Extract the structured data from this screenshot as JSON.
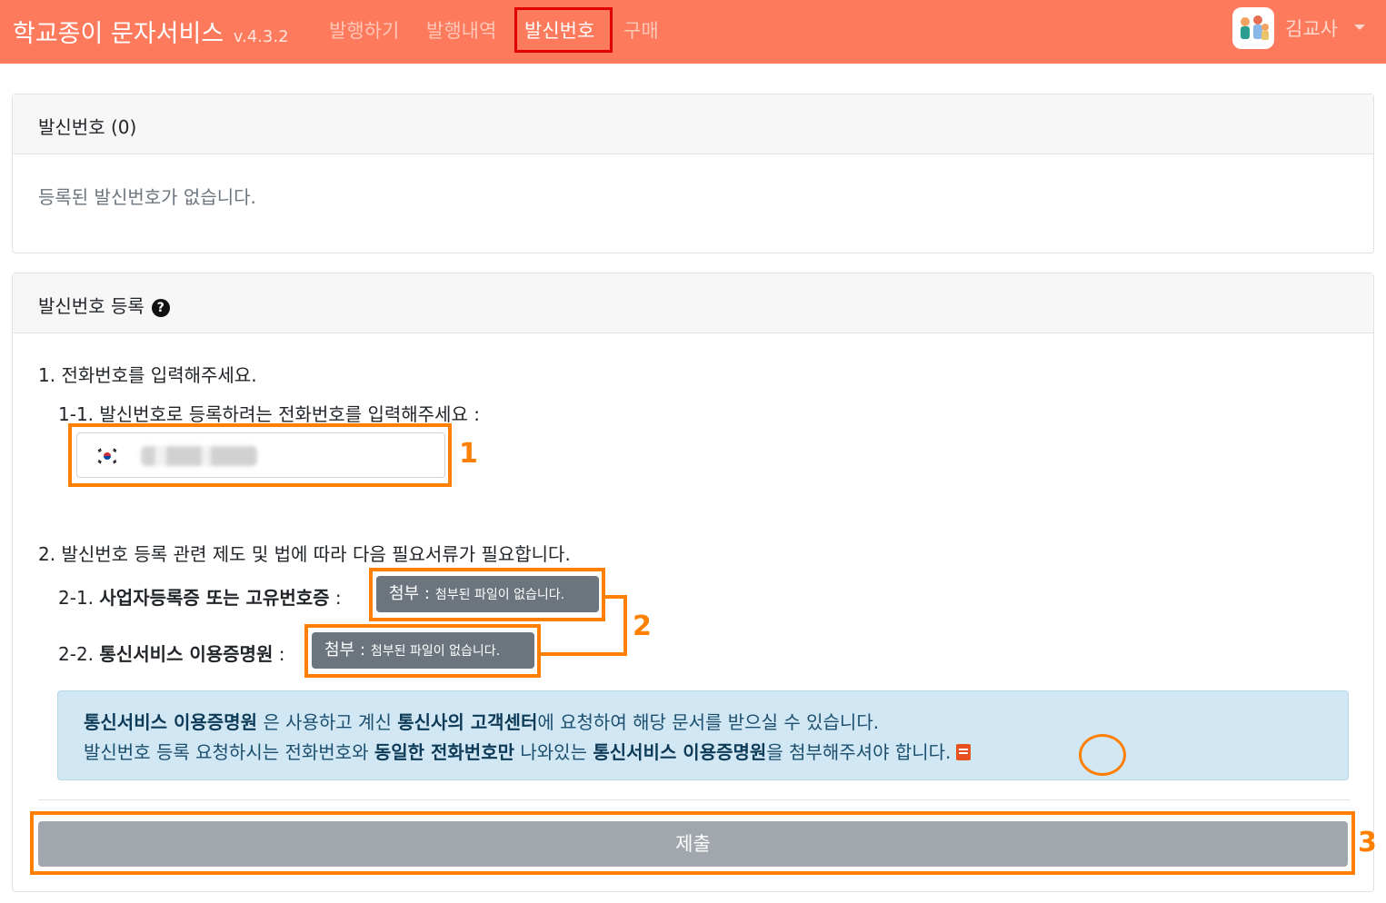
{
  "navbar": {
    "brand": "학교종이 문자서비스",
    "version": "v.4.3.2",
    "links": [
      "발행하기",
      "발행내역",
      "발신번호",
      "구매"
    ],
    "active_index": 2,
    "user_name": "김교사"
  },
  "sender_list": {
    "title": "발신번호 (0)",
    "empty_message": "등록된 발신번호가 없습니다."
  },
  "register": {
    "title": "발신번호 등록",
    "step1_label": "1. 전화번호를 입력해주세요.",
    "step1_1_label": "1-1. 발신번호로 등록하려는 전화번호를 입력해주세요 :",
    "step2_label": "2. 발신번호 등록 관련 제도 및 법에 따라 다음 필요서류가 필요합니다.",
    "doc1": {
      "prefix": "2-1. ",
      "name": "사업자등록증 또는 고유번호증",
      "suffix": " :"
    },
    "doc2": {
      "prefix": "2-2. ",
      "name": "통신서비스 이용증명원",
      "suffix": " :"
    },
    "attach_label": "첨부 :",
    "attach_status": "첨부된 파일이 없습니다.",
    "info": {
      "line1": {
        "b1": "통신서비스 이용증명원",
        "t1": " 은 사용하고 계신 ",
        "b2": "통신사의 고객센터",
        "t2": "에 요청하여 해당 문서를 받으실 수 있습니다."
      },
      "line2": {
        "t1": "발신번호 등록 요청하시는 전화번호와 ",
        "b1": "동일한 전화번호만",
        "t2": " 나와있는 ",
        "b2": "통신서비스 이용증명원",
        "t3": "을 첨부해주셔야 합니다."
      }
    },
    "submit_label": "제출"
  },
  "annotations": {
    "n1": "1",
    "n2": "2",
    "n3": "3"
  },
  "colors": {
    "navbar": "#fe7a5c",
    "annotation": "#ff7f00",
    "highlight": "#e00000",
    "button": "#6c757d"
  }
}
